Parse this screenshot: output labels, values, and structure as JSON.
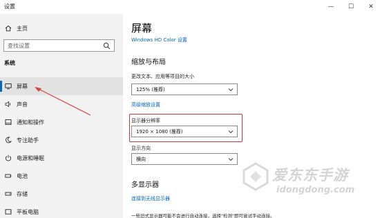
{
  "window": {
    "title": "设置",
    "min_glyph": "—",
    "max_glyph": "☐",
    "close_glyph": "✕"
  },
  "sidebar": {
    "home_label": "主页",
    "search_placeholder": "查找设置",
    "section_label": "系统",
    "items": [
      {
        "label": "屏幕",
        "icon": "monitor-icon",
        "selected": true
      },
      {
        "label": "声音",
        "icon": "speaker-icon"
      },
      {
        "label": "通知和操作",
        "icon": "notification-icon"
      },
      {
        "label": "专注助手",
        "icon": "moon-icon"
      },
      {
        "label": "电源和睡眠",
        "icon": "power-icon"
      },
      {
        "label": "电池",
        "icon": "battery-icon"
      },
      {
        "label": "存储",
        "icon": "storage-icon"
      },
      {
        "label": "平板电脑",
        "icon": "tablet-icon"
      }
    ]
  },
  "main": {
    "title": "屏幕",
    "cut_link": "Windows HD Color 设置",
    "scale_section": "缩放与布局",
    "scale_label": "更改文本、应用等项目的大小",
    "scale_value": "125% (推荐)",
    "advanced_scale_link": "高级缩放设置",
    "resolution_label": "显示器分辨率",
    "resolution_value": "1920 × 1080 (推荐)",
    "orientation_label": "显示方向",
    "orientation_value": "横向",
    "multi_section": "多显示器",
    "wireless_link": "连接到无线显示器",
    "hint_text": "一些旧式显示器可能不会进行自动连接，选择\"检测\"即可尝试手动连接。"
  },
  "watermark": {
    "brand": "爱东东手游",
    "domain": "idongdong.com"
  },
  "colors": {
    "accent": "#0067c0",
    "highlight_box": "#c0393b",
    "annotation_arrow": "#d9443f"
  }
}
